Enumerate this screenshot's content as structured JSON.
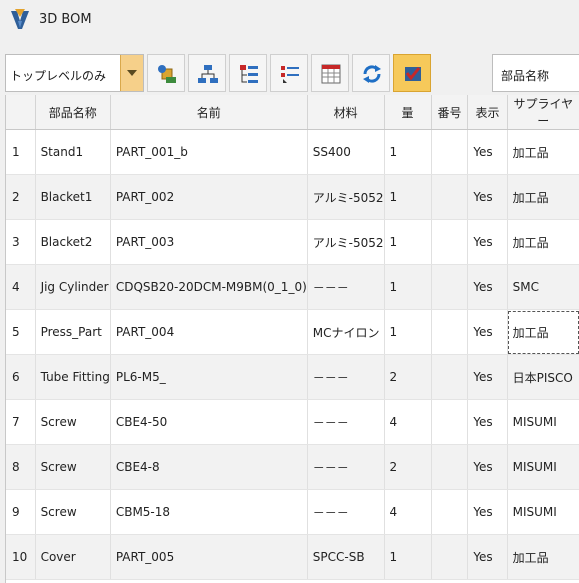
{
  "window": {
    "title": "3D BOM"
  },
  "toolbar": {
    "filter_value": "トップレベルのみ",
    "search_value": "部品名称",
    "buttons": [
      {
        "icon": "add-part-icon"
      },
      {
        "icon": "tree-structure-icon"
      },
      {
        "icon": "checklist-icon"
      },
      {
        "icon": "numbering-icon"
      },
      {
        "icon": "spreadsheet-icon"
      },
      {
        "icon": "refresh-icon"
      },
      {
        "icon": "view-model-icon",
        "active": true
      }
    ]
  },
  "table": {
    "headers": [
      "",
      "部品名称",
      "名前",
      "材料",
      "量",
      "番号",
      "表示",
      "サプライヤー"
    ],
    "rows": [
      [
        "1",
        "Stand1",
        "PART_001_b",
        "SS400",
        "1",
        "",
        "Yes",
        "加工品"
      ],
      [
        "2",
        "Blacket1",
        "PART_002",
        "アルミ-5052",
        "1",
        "",
        "Yes",
        "加工品"
      ],
      [
        "3",
        "Blacket2",
        "PART_003",
        "アルミ-5052",
        "1",
        "",
        "Yes",
        "加工品"
      ],
      [
        "4",
        "Jig Cylinder",
        "CDQSB20-20DCM-M9BM(0_1_0)",
        "－－－",
        "1",
        "",
        "Yes",
        "SMC"
      ],
      [
        "5",
        "Press_Part",
        "PART_004",
        "MCナイロン",
        "1",
        "",
        "Yes",
        "加工品"
      ],
      [
        "6",
        "Tube Fitting",
        "PL6-M5_",
        "－－－",
        "2",
        "",
        "Yes",
        "日本PISCO"
      ],
      [
        "7",
        "Screw",
        "CBE4-50",
        "－－－",
        "4",
        "",
        "Yes",
        "MISUMI"
      ],
      [
        "8",
        "Screw",
        "CBE4-8",
        "－－－",
        "2",
        "",
        "Yes",
        "MISUMI"
      ],
      [
        "9",
        "Screw",
        "CBM5-18",
        "－－－",
        "4",
        "",
        "Yes",
        "MISUMI"
      ],
      [
        "10",
        "Cover",
        "PART_005",
        "SPCC-SB",
        "1",
        "",
        "Yes",
        "加工品"
      ]
    ]
  },
  "colors": {
    "accent": "#f6c95a",
    "row_alt": "#f2f2f2"
  }
}
